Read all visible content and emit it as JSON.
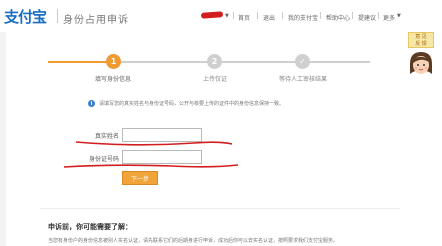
{
  "header": {
    "logo_text": "支付宝",
    "page_title": "身份占用申诉",
    "nav": {
      "account_caret": "▼",
      "items": [
        {
          "label": "首页"
        },
        {
          "label": "退出"
        },
        {
          "label": "我的支付宝"
        },
        {
          "label": "帮助中心"
        },
        {
          "label": "提建议"
        },
        {
          "label": "更多"
        }
      ]
    }
  },
  "steps": [
    {
      "number": "1",
      "label": "填写身份信息",
      "state": "active"
    },
    {
      "number": "2",
      "label": "上传仅证",
      "state": "pending"
    },
    {
      "number": "✓",
      "label": "等待人工审核结果",
      "state": "pending"
    }
  ],
  "colors": {
    "step_active": "#f09a32",
    "step_inactive": "#cfcfcf",
    "button": "#f0a43a",
    "brand": "#1a6fc4",
    "annotation": "#d21e1e"
  },
  "side_widget": {
    "tag_lines": [
      "意 见",
      "反 馈"
    ],
    "icon": "support-avatar-icon"
  },
  "info": {
    "icon": "info-icon",
    "text": "请填写您的真实姓名与身份证号码，公开与核要上传的证件中的身份信息保持一致。"
  },
  "form": {
    "name_label": "真实姓名",
    "name_value": "",
    "id_label": "身份证号码",
    "id_value": "",
    "next_button": "下一步"
  },
  "bottom": {
    "title": "申诉前，你可能需要了解：",
    "text": "当您有身份户的身份信息被别人实名认证，请先联系它们的后期身进行申诉，成功后你可以去实名认证，按照要求我们支付宝服务。"
  }
}
